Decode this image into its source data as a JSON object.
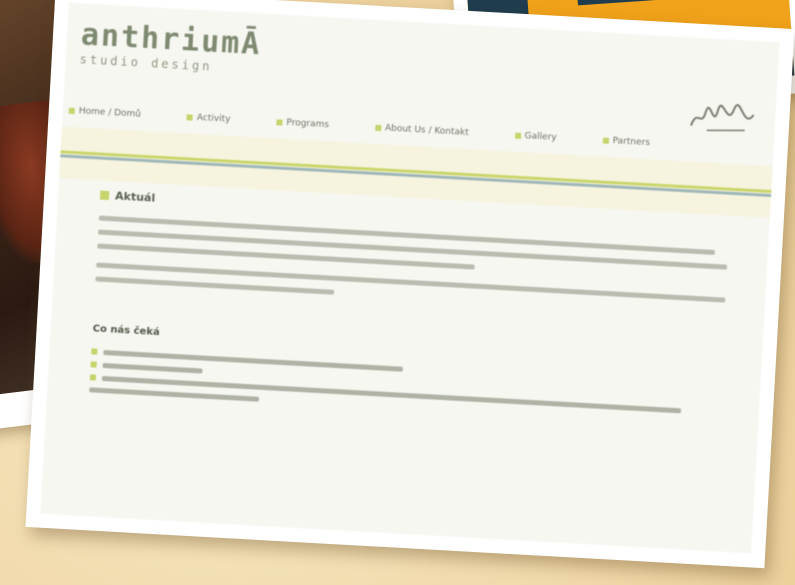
{
  "logo": {
    "name": "anthriumĀ",
    "subtitle": "studio design"
  },
  "nav": {
    "items": [
      "Home / Domů",
      "Activity",
      "Programs",
      "About Us / Kontakt",
      "Gallery",
      "Partners"
    ]
  },
  "main": {
    "heading": "Aktuál",
    "sub_heading": "Co nás čeká"
  },
  "colors": {
    "accent": "#c7d36b",
    "stripe": "#9fb7b8",
    "background": "#f1dcb0"
  }
}
